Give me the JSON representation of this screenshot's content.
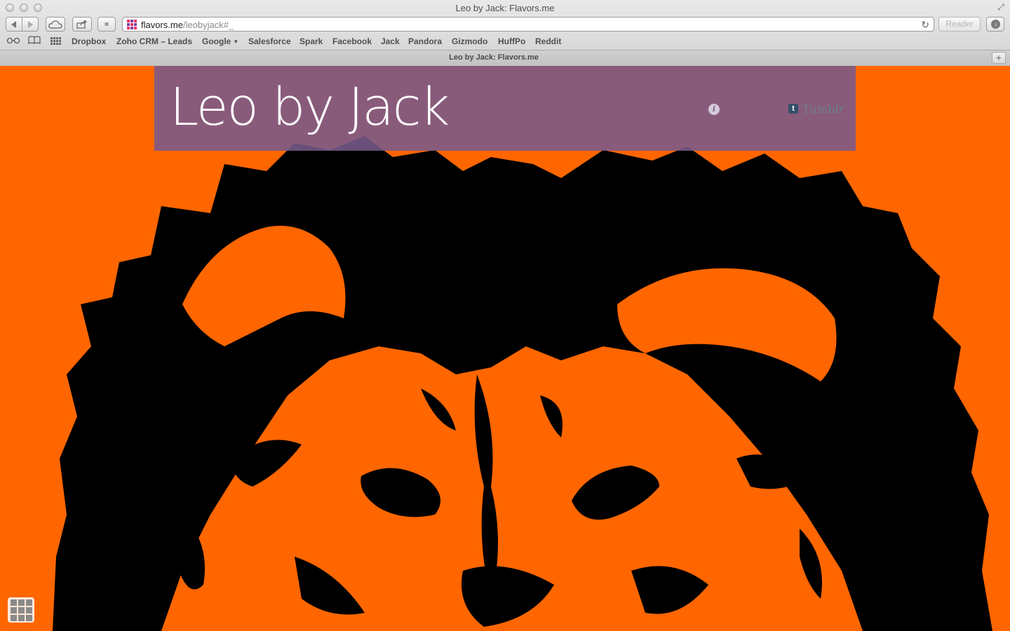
{
  "window": {
    "title": "Leo by Jack: Flavors.me"
  },
  "toolbar": {
    "url_host": "flavors.me",
    "url_path": "/leobyjack#_",
    "reader_label": "Reader"
  },
  "bookmarks": [
    {
      "label": "Dropbox"
    },
    {
      "label": "Zoho CRM – Leads"
    },
    {
      "label": "Google"
    },
    {
      "label": "Salesforce"
    },
    {
      "label": "Spark"
    },
    {
      "label": "Facebook"
    },
    {
      "label": "Jack"
    },
    {
      "label": "Pandora"
    },
    {
      "label": "Gizmodo"
    },
    {
      "label": "HuffPo"
    },
    {
      "label": "Reddit"
    }
  ],
  "tab": {
    "title": "Leo by Jack: Flavors.me"
  },
  "page": {
    "site_title": "Leo by Jack",
    "social_link": "Tumblr",
    "background_color": "#ff6600",
    "header_color": "#795a8c"
  }
}
